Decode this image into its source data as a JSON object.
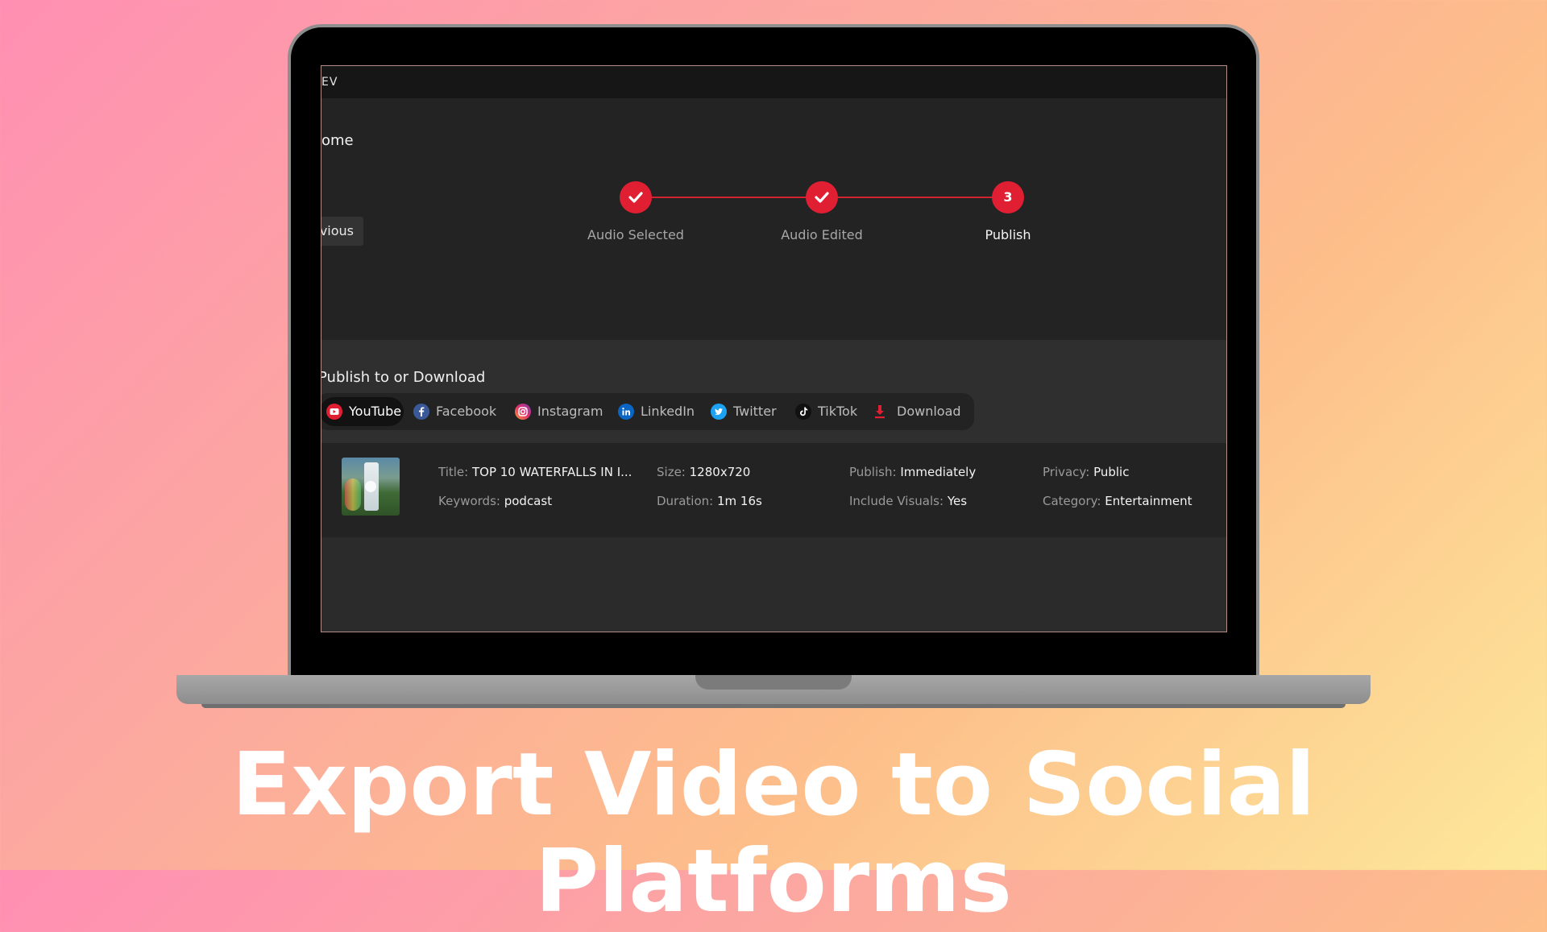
{
  "app": {
    "brand": "EV",
    "page_title": "ome"
  },
  "nav": {
    "previous_label": "vious"
  },
  "stepper": {
    "steps": [
      {
        "label": "Audio Selected",
        "number": "",
        "state": "done"
      },
      {
        "label": "Audio Edited",
        "number": "",
        "state": "done"
      },
      {
        "label": "Publish",
        "number": "3",
        "state": "active"
      }
    ]
  },
  "publish": {
    "heading": "Publish to or Download",
    "tabs": [
      {
        "label": "YouTube",
        "icon": "youtube-icon",
        "selected": true
      },
      {
        "label": "Facebook",
        "icon": "facebook-icon"
      },
      {
        "label": "Instagram",
        "icon": "instagram-icon"
      },
      {
        "label": "LinkedIn",
        "icon": "linkedin-icon"
      },
      {
        "label": "Twitter",
        "icon": "twitter-icon"
      },
      {
        "label": "TikTok",
        "icon": "tiktok-icon"
      },
      {
        "label": "Download",
        "icon": "download-icon"
      }
    ]
  },
  "video": {
    "title_key": "Title:",
    "title": "TOP 10 WATERFALLS IN I...",
    "keywords_key": "Keywords:",
    "keywords": "podcast",
    "size_key": "Size:",
    "size": "1280x720",
    "duration_key": "Duration:",
    "duration": "1m 16s",
    "publish_key": "Publish:",
    "publish": "Immediately",
    "visuals_key": "Include Visuals:",
    "visuals": "Yes",
    "privacy_key": "Privacy:",
    "privacy": "Public",
    "category_key": "Category:",
    "category": "Entertainment"
  },
  "headline": "Export Video to Social Platforms",
  "colors": {
    "accent": "#e01f33",
    "background_dark": "#232323"
  }
}
